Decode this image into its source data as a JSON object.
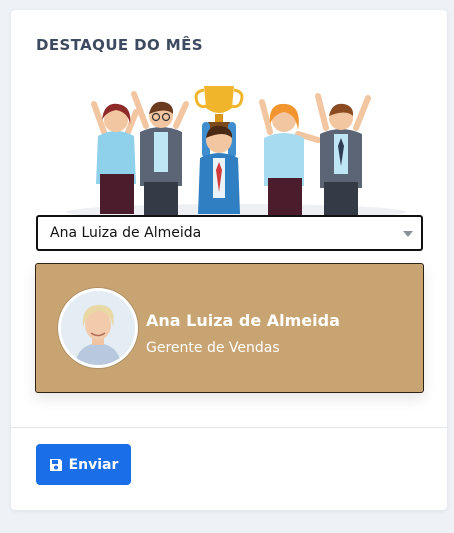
{
  "card": {
    "title": "DESTAQUE DO MÊS"
  },
  "illustration": {
    "icon": "team-celebrating-trophy-illustration"
  },
  "select": {
    "value": "Ana Luiza de Almeida"
  },
  "profile": {
    "name": "Ana Luiza de Almeida",
    "role": "Gerente de Vendas",
    "card_color": "#c8a472",
    "avatar_icon": "user-photo-avatar"
  },
  "actions": {
    "submit_label": "Enviar",
    "submit_icon": "save-icon",
    "submit_color": "#1a6ee8"
  }
}
